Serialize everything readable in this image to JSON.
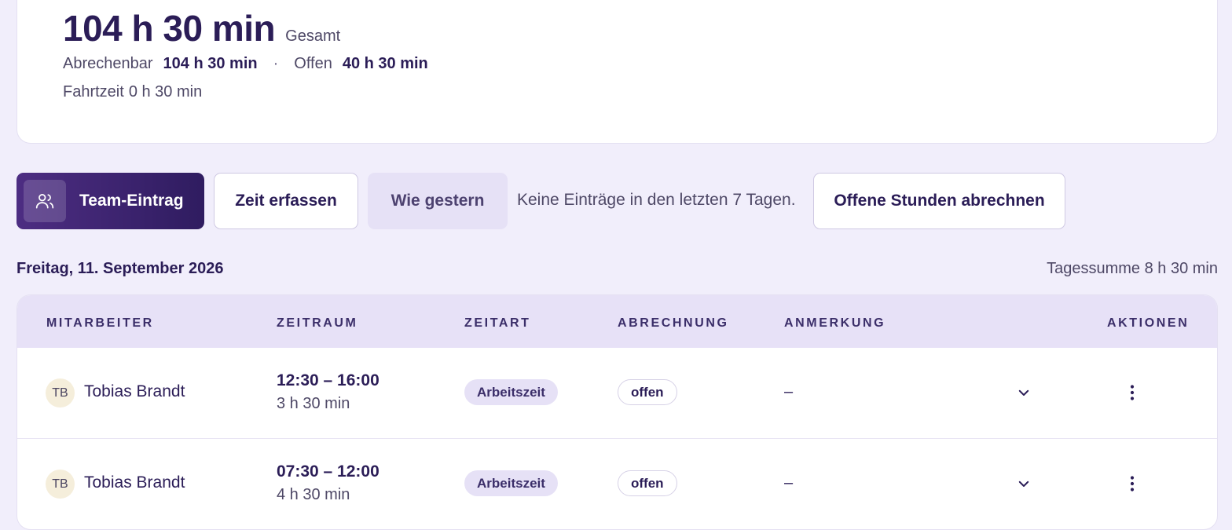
{
  "summary": {
    "total_value": "104 h 30 min",
    "total_suffix": "Gesamt",
    "billable_label": "Abrechenbar",
    "billable_value": "104 h 30 min",
    "separator": "·",
    "open_label": "Offen",
    "open_value": "40 h 30 min",
    "travel_label": "Fahrtzeit",
    "travel_value": "0 h 30 min"
  },
  "toolbar": {
    "team_entry": "Team-Eintrag",
    "team_icon": "users-icon",
    "record_time": "Zeit erfassen",
    "like_yesterday": "Wie gestern",
    "hint": "Keine Einträge in den letzten 7 Tagen.",
    "bill_open": "Offene Stunden abrechnen"
  },
  "day": {
    "title": "Freitag, 11. September 2026",
    "sum_label": "Tagessumme",
    "sum_value": "8 h 30 min"
  },
  "table": {
    "headers": {
      "employee": "MITARBEITER",
      "period": "ZEITRAUM",
      "time_type": "ZEITART",
      "billing": "ABRECHNUNG",
      "note": "ANMERKUNG",
      "actions": "AKTIONEN"
    },
    "rows": [
      {
        "initials": "TB",
        "name": "Tobias Brandt",
        "time_range": "12:30 – 16:00",
        "duration": "3 h 30 min",
        "time_type": "Arbeitszeit",
        "billing": "offen",
        "note": "–"
      },
      {
        "initials": "TB",
        "name": "Tobias Brandt",
        "time_range": "07:30 – 12:00",
        "duration": "4 h 30 min",
        "time_type": "Arbeitszeit",
        "billing": "offen",
        "note": "–"
      }
    ]
  },
  "colors": {
    "primary": "#3a2270",
    "background": "#f1eefb",
    "header_bg": "#e7e1f7"
  }
}
